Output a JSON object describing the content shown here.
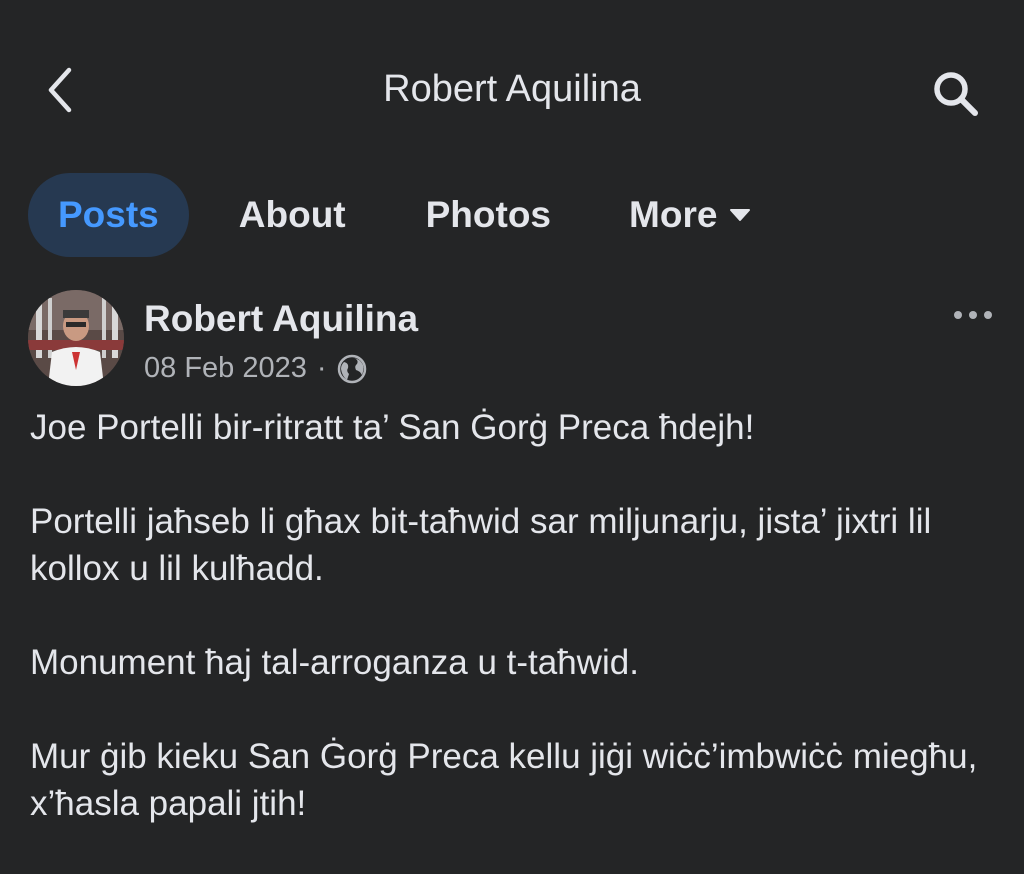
{
  "header": {
    "title": "Robert Aquilina",
    "back_icon": "chevron-left-icon",
    "search_icon": "search-icon"
  },
  "tabs": [
    {
      "label": "Posts",
      "active": true
    },
    {
      "label": "About",
      "active": false
    },
    {
      "label": "Photos",
      "active": false
    },
    {
      "label": "More",
      "active": false
    }
  ],
  "post": {
    "author": "Robert Aquilina",
    "date": "08 Feb 2023",
    "separator": "·",
    "privacy_icon": "globe-icon",
    "paragraphs": [
      "Joe Portelli bir-ritratt ta’ San Ġorġ Preca ħdejh!",
      "Portelli jaħseb li għax bit-taħwid sar miljunarju, jista’ jixtri lil kollox u lil kulħadd.",
      "Monument ħaj tal-arroganza u t-taħwid.",
      "Mur ġib kieku San Ġorġ Preca kellu jiġi wiċċ’imbwiċċ miegħu, x’ħasla papali jtih!"
    ]
  },
  "colors": {
    "background": "#242526",
    "text": "#e4e6eb",
    "secondary_text": "#b0b3b8",
    "accent": "#4599ff",
    "active_tab_bg": "#263951"
  }
}
